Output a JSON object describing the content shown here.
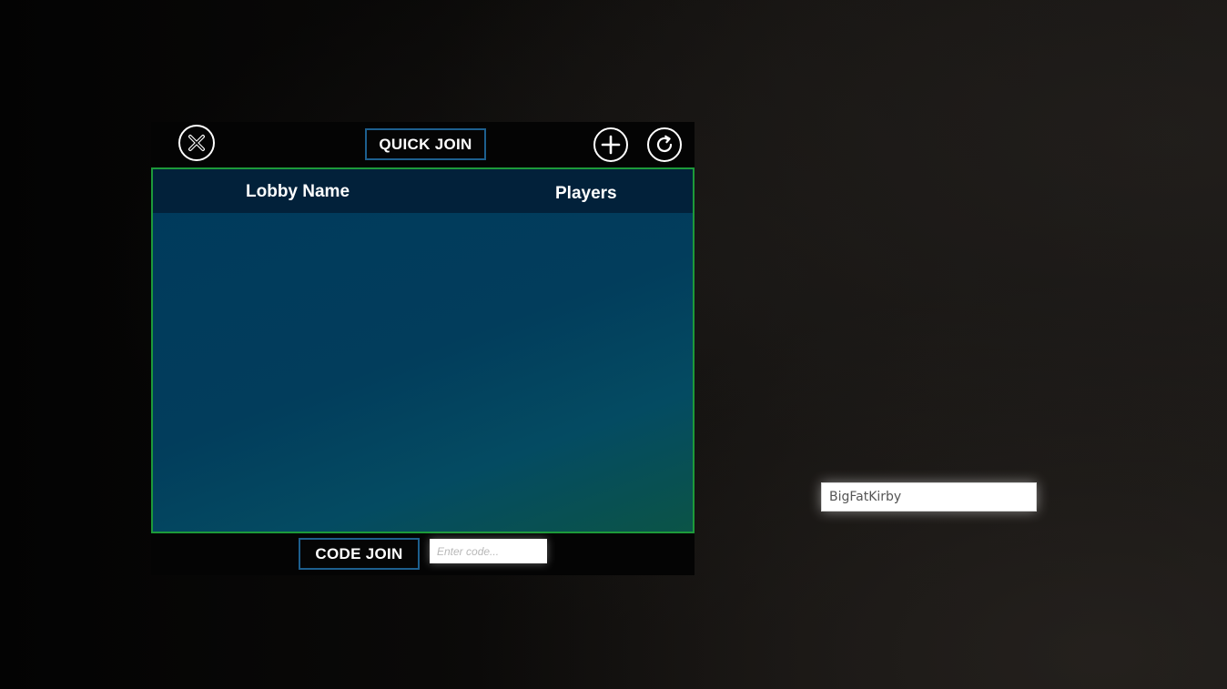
{
  "lobby_panel": {
    "quick_join_label": "QUICK JOIN",
    "close_icon": "close-circle-icon",
    "add_icon": "plus-circle-icon",
    "refresh_icon": "refresh-circle-icon",
    "columns": [
      "Lobby Name",
      "Players"
    ],
    "lobbies": [],
    "code_join_label": "CODE JOIN",
    "code_input": {
      "value": "",
      "placeholder": "Enter code..."
    },
    "colors": {
      "button_border": "#1d5f8e",
      "list_border": "#1d9a3a",
      "list_background": "#003a5c",
      "header_background": "#02213a"
    }
  },
  "player_name_input": {
    "value": "BigFatKirby",
    "placeholder": ""
  }
}
